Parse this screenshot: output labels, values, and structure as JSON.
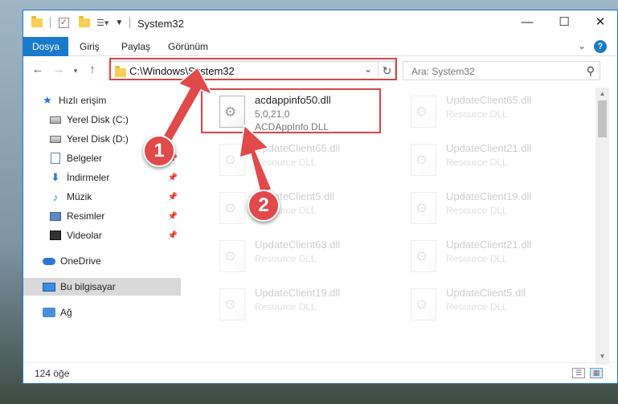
{
  "window": {
    "title": "System32",
    "controls": {
      "minimize": "—",
      "maximize": "☐",
      "close": "✕"
    }
  },
  "ribbon": {
    "tabs": [
      "Dosya",
      "Giriş",
      "Paylaş",
      "Görünüm"
    ],
    "help": "?",
    "expand": "⌄"
  },
  "nav": {
    "address": "C:\\Windows\\System32",
    "search_placeholder": "Ara: System32"
  },
  "sidebar": {
    "items": [
      {
        "label": "Hızlı erişim",
        "icon": "star-icon",
        "pinned": false
      },
      {
        "label": "Yerel Disk (C:)",
        "icon": "disk-icon",
        "pinned": false
      },
      {
        "label": "Yerel Disk (D:)",
        "icon": "disk-icon",
        "pinned": false
      },
      {
        "label": "Belgeler",
        "icon": "documents-icon",
        "pinned": true
      },
      {
        "label": "İndirmeler",
        "icon": "download-icon",
        "pinned": true
      },
      {
        "label": "Müzik",
        "icon": "music-icon",
        "pinned": true
      },
      {
        "label": "Resimler",
        "icon": "pictures-icon",
        "pinned": true
      },
      {
        "label": "Videolar",
        "icon": "videos-icon",
        "pinned": true
      },
      {
        "label": "OneDrive",
        "icon": "cloud-icon",
        "pinned": false
      },
      {
        "label": "Bu bilgisayar",
        "icon": "computer-icon",
        "pinned": false,
        "selected": true
      },
      {
        "label": "Ağ",
        "icon": "network-icon",
        "pinned": false
      }
    ]
  },
  "files": [
    {
      "name": "acdappinfo50.dll",
      "line2": "5,0,21,0",
      "line3": "ACDAppInfo DLL",
      "highlighted": true
    },
    {
      "name": "UpdateClient65.dll",
      "line2": "Resource DLL",
      "line3": ""
    },
    {
      "name": "UpdateClient65.dll",
      "line2": "Resource DLL",
      "line3": ""
    },
    {
      "name": "UpdateClient21.dll",
      "line2": "Resource DLL",
      "line3": ""
    },
    {
      "name": "UpdateClient5.dll",
      "line2": "Resource DLL",
      "line3": ""
    },
    {
      "name": "UpdateClient19.dll",
      "line2": "Resource DLL",
      "line3": ""
    },
    {
      "name": "UpdateClient63.dll",
      "line2": "Resource DLL",
      "line3": ""
    },
    {
      "name": "UpdateClient21.dll",
      "line2": "Resource DLL",
      "line3": ""
    },
    {
      "name": "UpdateClient19.dll",
      "line2": "Resource DLL",
      "line3": ""
    },
    {
      "name": "UpdateClient5.dll",
      "line2": "Resource DLL",
      "line3": ""
    }
  ],
  "status": {
    "count": "124 öğe"
  },
  "annotations": {
    "badge1": "1",
    "badge2": "2",
    "color": "#e04a4a"
  }
}
